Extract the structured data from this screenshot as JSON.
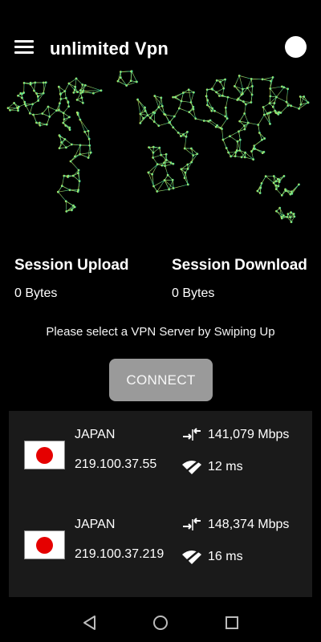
{
  "app": {
    "title": "unlimited Vpn"
  },
  "stats": {
    "upload_label": "Session Upload",
    "upload_value": "0 Bytes",
    "download_label": "Session Download",
    "download_value": "0 Bytes"
  },
  "hint": "Please select a VPN Server by Swiping Up",
  "connect_label": "CONNECT",
  "servers": [
    {
      "country": "JAPAN",
      "ip": "219.100.37.55",
      "speed": "141,079 Mbps",
      "ping": "12 ms"
    },
    {
      "country": "JAPAN",
      "ip": "219.100.37.219",
      "speed": "148,374 Mbps",
      "ping": "16 ms"
    }
  ],
  "colors": {
    "map_start": "#d6ea52",
    "map_end": "#20e0b0",
    "connect_button": "#9a9a9a",
    "panel": "#1a1a1a"
  },
  "icons": [
    "menu-icon",
    "toggle-circle-icon",
    "world-map-network",
    "japan-flag-icon",
    "speed-arrows-icon",
    "wifi-icon",
    "back-icon",
    "home-icon",
    "recents-icon"
  ]
}
